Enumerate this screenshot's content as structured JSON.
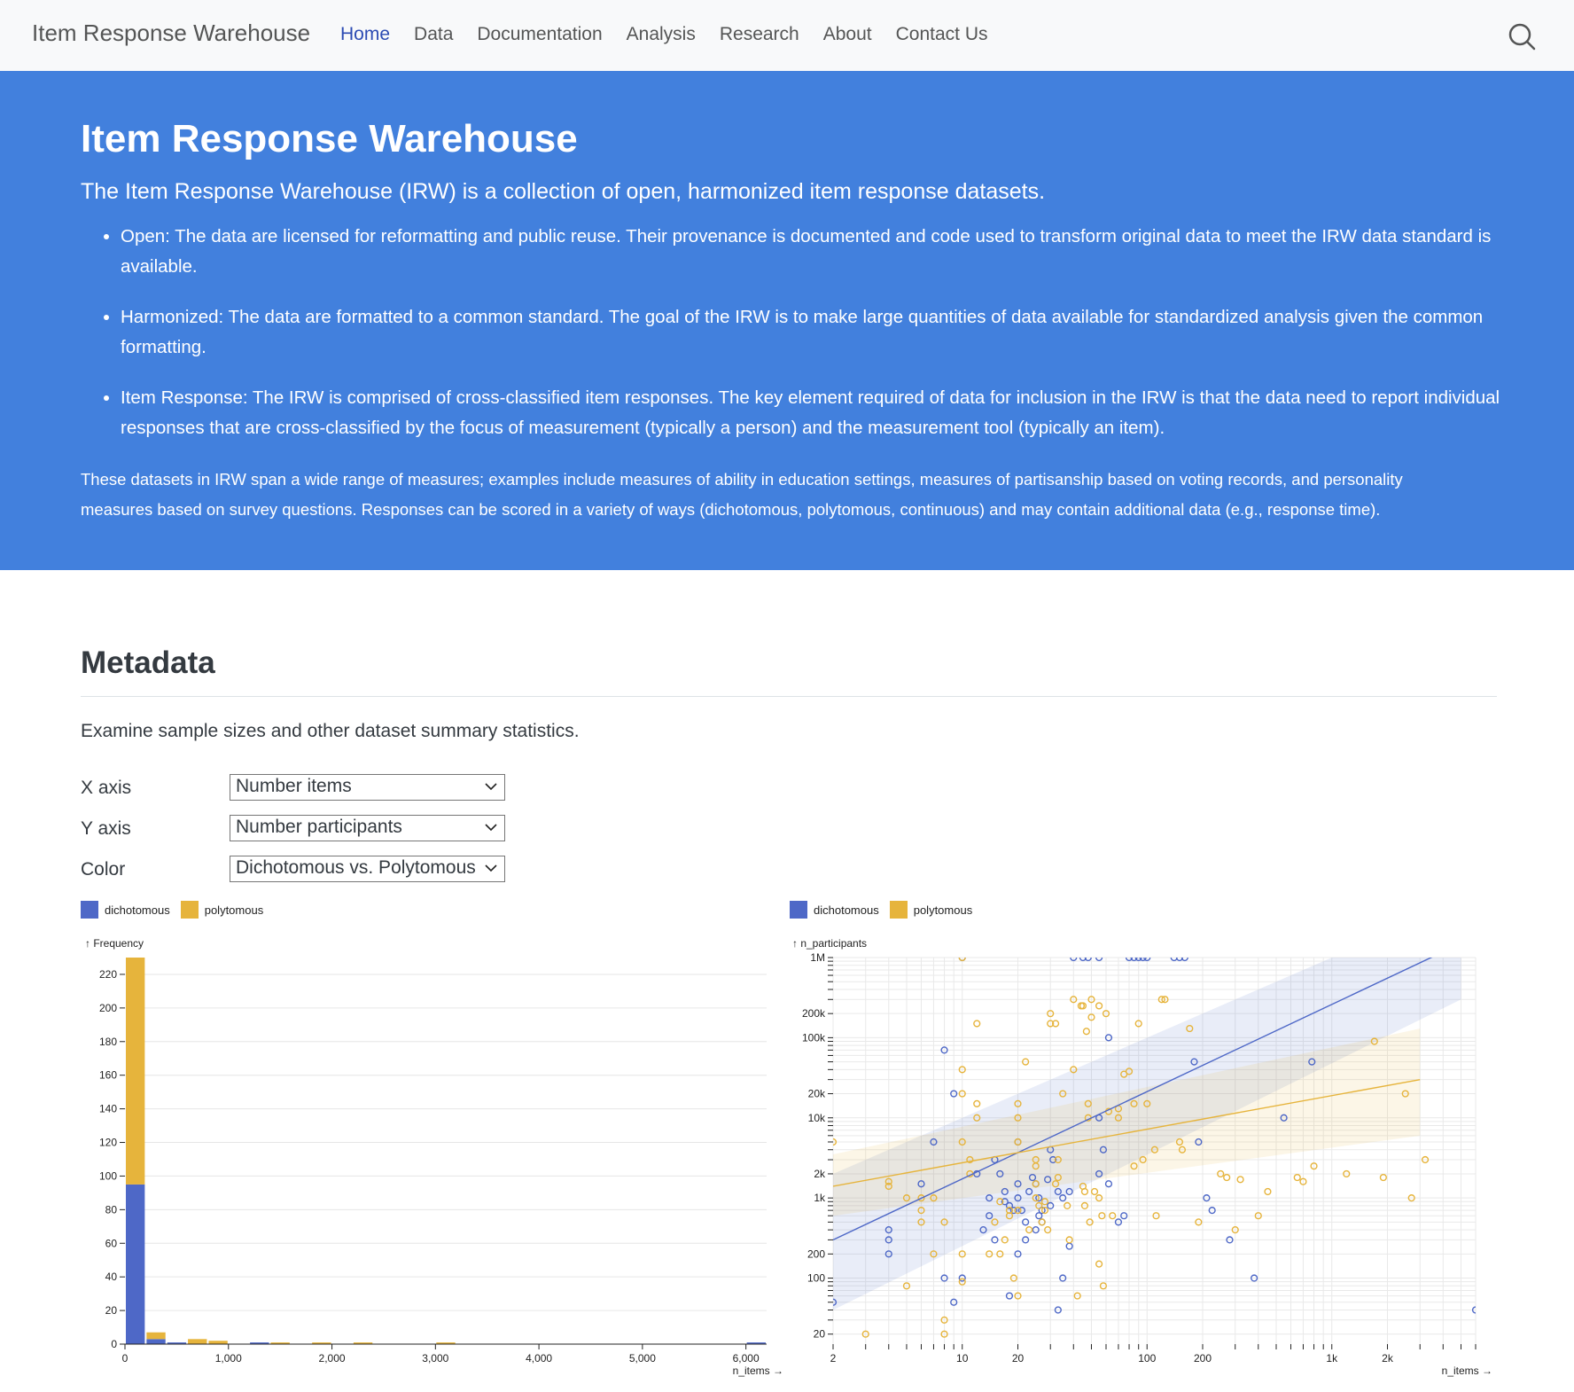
{
  "navbar": {
    "brand": "Item Response Warehouse",
    "items": [
      "Home",
      "Data",
      "Documentation",
      "Analysis",
      "Research",
      "About",
      "Contact Us"
    ],
    "active": "Home",
    "search_icon": "search-icon"
  },
  "hero": {
    "title": "Item Response Warehouse",
    "subtitle": "The Item Response Warehouse (IRW) is a collection of open, harmonized item response datasets.",
    "bullets": [
      "Open: The data are licensed for reformatting and public reuse. Their provenance is documented and code used to transform original data to meet the IRW data standard is available.",
      "Harmonized: The data are formatted to a common standard. The goal of the IRW is to make large quantities of data available for standardized analysis given the common formatting.",
      "Item Response: The IRW is comprised of cross-classified item responses. The key element required of data for inclusion in the IRW is that the data need to report individual responses that are cross-classified by the focus of measurement (typically a person) and the measurement tool (typically an item)."
    ],
    "paragraph": "These datasets in IRW span a wide range of measures; examples include measures of ability in education settings, measures of partisanship based on voting records, and personality measures based on survey questions. Responses can be scored in a variety of ways (dichotomous, polytomous, continuous) and may contain additional data (e.g., response time)."
  },
  "metadata": {
    "title": "Metadata",
    "description": "Examine sample sizes and other dataset summary statistics.",
    "controls": {
      "x_label": "X axis",
      "x_value": "Number items",
      "y_label": "Y axis",
      "y_value": "Number participants",
      "color_label": "Color",
      "color_value": "Dichotomous vs. Polytomous"
    }
  },
  "colors": {
    "dichotomous": "#4e68c7",
    "polytomous": "#e6b43c",
    "hero": "#4280dd",
    "nav_active": "#2c4bb3"
  },
  "chart_data": [
    {
      "type": "bar",
      "legend": [
        "dichotomous",
        "polytomous"
      ],
      "ylabel": "↑ Frequency",
      "xlabel": "n_items →",
      "ylim": [
        0,
        230
      ],
      "yticks": [
        0,
        20,
        40,
        60,
        80,
        100,
        120,
        140,
        160,
        180,
        200,
        220
      ],
      "xticks": [
        0,
        1000,
        2000,
        3000,
        4000,
        5000,
        6000
      ],
      "xtick_labels": [
        "0",
        "1,000",
        "2,000",
        "3,000",
        "4,000",
        "5,000",
        "6,000"
      ],
      "xlim": [
        0,
        6200
      ],
      "bin_width": 200,
      "bins": [
        0,
        200,
        400,
        600,
        800,
        1000,
        1200,
        1400,
        1600,
        1800,
        2000,
        2200,
        2400,
        2600,
        2800,
        3000,
        3200,
        3400,
        3600,
        3800,
        4000,
        4200,
        4400,
        4600,
        4800,
        5000,
        5200,
        5400,
        5600,
        5800,
        6000
      ],
      "series": [
        {
          "name": "dichotomous",
          "values": [
            95,
            3,
            1,
            0,
            0,
            0,
            1,
            0,
            0,
            0,
            0,
            0,
            0,
            0,
            0,
            0,
            0,
            0,
            0,
            0,
            0,
            0,
            0,
            0,
            0,
            0,
            0,
            0,
            0,
            0,
            1
          ]
        },
        {
          "name": "polytomous",
          "values": [
            135,
            4,
            0,
            3,
            2,
            0,
            0,
            1,
            0,
            1,
            0,
            1,
            0,
            0,
            0,
            1,
            0,
            0,
            0,
            0,
            0,
            0,
            0,
            0,
            0,
            0,
            0,
            0,
            0,
            0,
            0
          ]
        }
      ],
      "grid": true
    },
    {
      "type": "scatter",
      "legend": [
        "dichotomous",
        "polytomous"
      ],
      "ylabel": "↑ n_participants",
      "xlabel": "n_items →",
      "x_scale": "log",
      "y_scale": "log",
      "xlim": [
        2,
        6000
      ],
      "ylim": [
        15,
        1000000
      ],
      "xticks": [
        2,
        10,
        20,
        100,
        200,
        1000,
        2000
      ],
      "xtick_labels": [
        "2",
        "10",
        "20",
        "100",
        "200",
        "1k",
        "2k"
      ],
      "yticks": [
        20,
        100,
        200,
        1000,
        2000,
        10000,
        20000,
        100000,
        200000,
        1000000
      ],
      "ytick_labels": [
        "20",
        "100",
        "200",
        "1k",
        "2k",
        "10k",
        "20k",
        "100k",
        "200k",
        "1M"
      ],
      "grid": true,
      "trend": {
        "dichotomous": {
          "x": [
            2,
            5000
          ],
          "y": [
            300,
            1500000
          ],
          "band_low": [
            40,
            300000
          ],
          "band_high": [
            2000,
            5000000
          ]
        },
        "polytomous": {
          "x": [
            2,
            3000
          ],
          "y": [
            1400,
            30000
          ],
          "band_low": [
            600,
            6000
          ],
          "band_high": [
            3500,
            130000
          ]
        }
      },
      "series": [
        {
          "name": "dichotomous",
          "points": [
            [
              2,
              50
            ],
            [
              4,
              300
            ],
            [
              4,
              400
            ],
            [
              4,
              200
            ],
            [
              6,
              1500
            ],
            [
              7,
              5000
            ],
            [
              8,
              70000
            ],
            [
              8,
              100
            ],
            [
              9,
              50
            ],
            [
              9,
              20000
            ],
            [
              10,
              1000000
            ],
            [
              10,
              100
            ],
            [
              12,
              2000
            ],
            [
              13,
              400
            ],
            [
              14,
              600
            ],
            [
              14,
              1000
            ],
            [
              15,
              300
            ],
            [
              15,
              3000
            ],
            [
              16,
              2000
            ],
            [
              17,
              1200
            ],
            [
              17,
              900
            ],
            [
              18,
              800
            ],
            [
              18,
              60
            ],
            [
              19,
              700
            ],
            [
              20,
              200
            ],
            [
              20,
              1000
            ],
            [
              20,
              5000
            ],
            [
              20,
              1500
            ],
            [
              21,
              700
            ],
            [
              22,
              300
            ],
            [
              22,
              500
            ],
            [
              23,
              1200
            ],
            [
              24,
              1800
            ],
            [
              25,
              1500
            ],
            [
              25,
              400
            ],
            [
              26,
              600
            ],
            [
              26,
              1000
            ],
            [
              27,
              700
            ],
            [
              27,
              500
            ],
            [
              29,
              1700
            ],
            [
              30,
              800
            ],
            [
              30,
              4000
            ],
            [
              31,
              3000
            ],
            [
              33,
              1200
            ],
            [
              33,
              40
            ],
            [
              35,
              1000
            ],
            [
              35,
              100
            ],
            [
              38,
              1200
            ],
            [
              38,
              250
            ],
            [
              40,
              1000000
            ],
            [
              45,
              1000000
            ],
            [
              48,
              1000000
            ],
            [
              55,
              1000000
            ],
            [
              55,
              2000
            ],
            [
              55,
              10000
            ],
            [
              58,
              4000
            ],
            [
              62,
              1500
            ],
            [
              62,
              100000
            ],
            [
              70,
              500
            ],
            [
              75,
              600
            ],
            [
              80,
              1000000
            ],
            [
              85,
              1000000
            ],
            [
              90,
              1000000
            ],
            [
              95,
              1000000
            ],
            [
              100,
              1000000
            ],
            [
              140,
              1000000
            ],
            [
              150,
              1000000
            ],
            [
              160,
              1000000
            ],
            [
              180,
              50000
            ],
            [
              190,
              5000
            ],
            [
              210,
              1000
            ],
            [
              225,
              700
            ],
            [
              280,
              300
            ],
            [
              380,
              100
            ],
            [
              550,
              10000
            ],
            [
              780,
              50000
            ],
            [
              6000,
              40
            ]
          ]
        },
        {
          "name": "polytomous",
          "points": [
            [
              2,
              5000
            ],
            [
              3,
              20
            ],
            [
              4,
              1400
            ],
            [
              4,
              1600
            ],
            [
              5,
              80
            ],
            [
              5,
              1000
            ],
            [
              6,
              700
            ],
            [
              6,
              500
            ],
            [
              6,
              1000
            ],
            [
              7,
              200
            ],
            [
              7,
              1000
            ],
            [
              8,
              20
            ],
            [
              8,
              30
            ],
            [
              8,
              500
            ],
            [
              10,
              1000000
            ],
            [
              10,
              5000
            ],
            [
              10,
              20000
            ],
            [
              10,
              40000
            ],
            [
              10,
              200
            ],
            [
              10,
              90
            ],
            [
              11,
              3000
            ],
            [
              11,
              2000
            ],
            [
              12,
              15000
            ],
            [
              12,
              10000
            ],
            [
              12,
              150000
            ],
            [
              14,
              200
            ],
            [
              15,
              500
            ],
            [
              16,
              200
            ],
            [
              16,
              900
            ],
            [
              17,
              300
            ],
            [
              18,
              600
            ],
            [
              18,
              700
            ],
            [
              19,
              100
            ],
            [
              20,
              10000
            ],
            [
              20,
              15000
            ],
            [
              20,
              5000
            ],
            [
              20,
              700
            ],
            [
              20,
              60
            ],
            [
              22,
              50000
            ],
            [
              23,
              400
            ],
            [
              25,
              1000
            ],
            [
              25,
              1500
            ],
            [
              25,
              3000
            ],
            [
              25,
              2500
            ],
            [
              26,
              800
            ],
            [
              27,
              500
            ],
            [
              28,
              900
            ],
            [
              28,
              700
            ],
            [
              29,
              400
            ],
            [
              30,
              150000
            ],
            [
              30,
              200000
            ],
            [
              32,
              150000
            ],
            [
              32,
              1500
            ],
            [
              33,
              3000
            ],
            [
              33,
              1800
            ],
            [
              35,
              20000
            ],
            [
              37,
              800
            ],
            [
              38,
              300
            ],
            [
              40,
              300000
            ],
            [
              40,
              40000
            ],
            [
              42,
              60
            ],
            [
              44,
              250000
            ],
            [
              45,
              250000
            ],
            [
              45,
              1400
            ],
            [
              46,
              800
            ],
            [
              46,
              1200
            ],
            [
              47,
              120000
            ],
            [
              48,
              10000
            ],
            [
              48,
              15000
            ],
            [
              49,
              500
            ],
            [
              50,
              300000
            ],
            [
              50,
              180000
            ],
            [
              52,
              1200
            ],
            [
              55,
              250000
            ],
            [
              55,
              1000
            ],
            [
              55,
              150
            ],
            [
              57,
              600
            ],
            [
              58,
              80
            ],
            [
              60,
              200000
            ],
            [
              62,
              12000
            ],
            [
              65,
              600
            ],
            [
              70,
              10000
            ],
            [
              70,
              13000
            ],
            [
              75,
              35000
            ],
            [
              80,
              38000
            ],
            [
              85,
              2500
            ],
            [
              85,
              15000
            ],
            [
              90,
              150000
            ],
            [
              95,
              3000
            ],
            [
              100,
              15000
            ],
            [
              110,
              4000
            ],
            [
              112,
              600
            ],
            [
              120,
              300000
            ],
            [
              125,
              300000
            ],
            [
              150,
              5000
            ],
            [
              155,
              4000
            ],
            [
              170,
              130000
            ],
            [
              190,
              500
            ],
            [
              250,
              2000
            ],
            [
              270,
              1800
            ],
            [
              300,
              400
            ],
            [
              320,
              1700
            ],
            [
              400,
              600
            ],
            [
              450,
              1200
            ],
            [
              650,
              1800
            ],
            [
              700,
              1600
            ],
            [
              800,
              2500
            ],
            [
              1200,
              2000
            ],
            [
              1700,
              90000
            ],
            [
              1900,
              1800
            ],
            [
              2500,
              20000
            ],
            [
              2700,
              1000
            ],
            [
              3200,
              3000
            ]
          ]
        }
      ]
    }
  ]
}
